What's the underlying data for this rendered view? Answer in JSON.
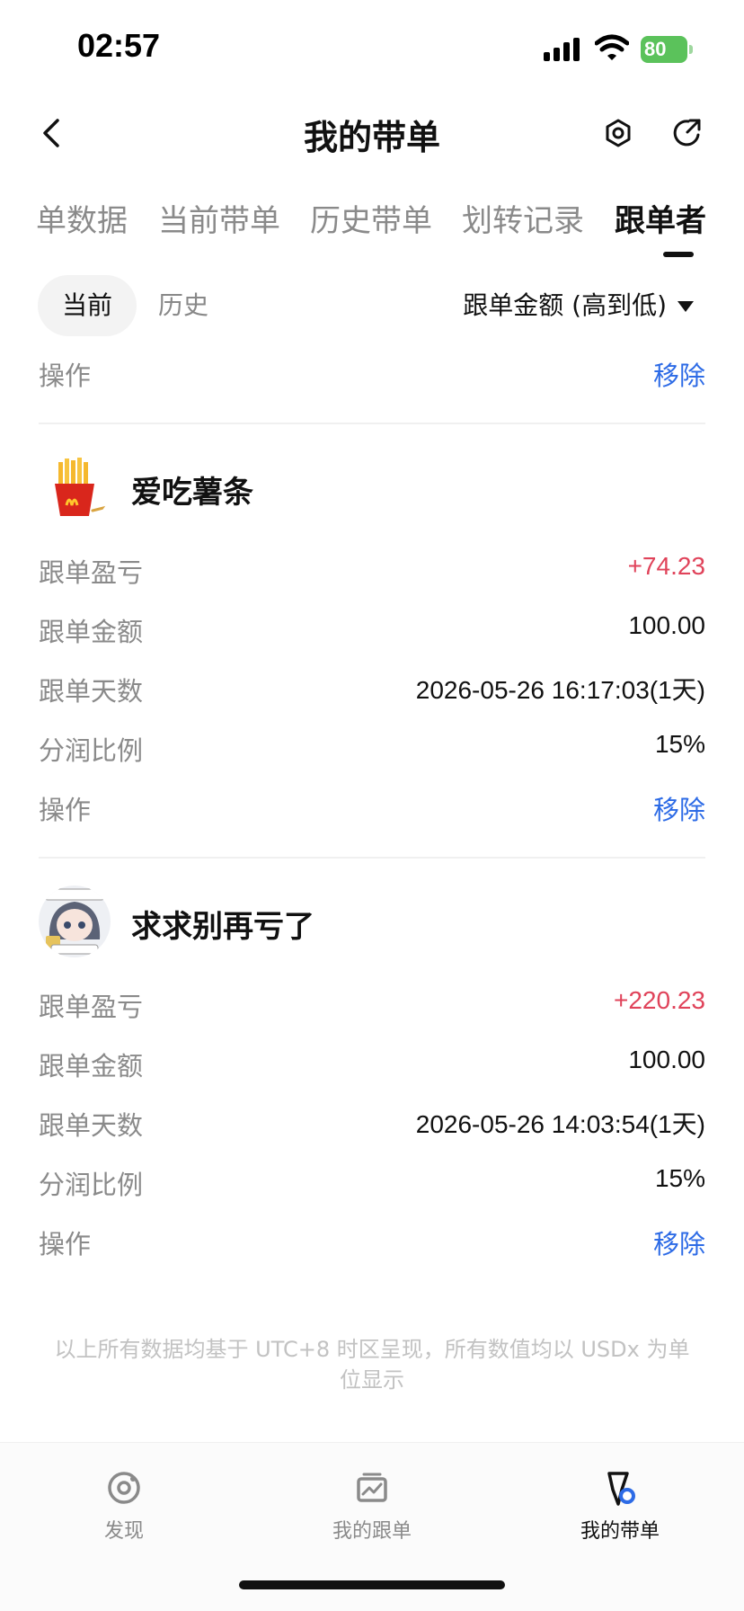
{
  "status_bar": {
    "time": "02:57",
    "battery": "80"
  },
  "header": {
    "title": "我的带单"
  },
  "tabs": [
    {
      "label": "单数据",
      "active": false
    },
    {
      "label": "当前带单",
      "active": false
    },
    {
      "label": "历史带单",
      "active": false
    },
    {
      "label": "划转记录",
      "active": false
    },
    {
      "label": "跟单者",
      "active": true
    }
  ],
  "subtabs": {
    "current": "当前",
    "history": "历史"
  },
  "sort": {
    "selected": "跟单金额 (高到低)"
  },
  "top_row": {
    "label": "操作",
    "action": "移除"
  },
  "followers": [
    {
      "name": "爱吃薯条",
      "avatar_icon": "french-fries-icon",
      "rows": [
        {
          "label": "跟单盈亏",
          "value": "+74.23"
        },
        {
          "label": "跟单金额",
          "value": "100.00"
        },
        {
          "label": "跟单天数",
          "value": "2026-05-26 16:17:03(1天)"
        },
        {
          "label": "分润比例",
          "value": "15%"
        },
        {
          "label": "操作",
          "value": "移除"
        }
      ]
    },
    {
      "name": "求求别再亏了",
      "avatar_icon": "anime-girl-avatar",
      "rows": [
        {
          "label": "跟单盈亏",
          "value": "+220.23"
        },
        {
          "label": "跟单金额",
          "value": "100.00"
        },
        {
          "label": "跟单天数",
          "value": "2026-05-26 14:03:54(1天)"
        },
        {
          "label": "分润比例",
          "value": "15%"
        },
        {
          "label": "操作",
          "value": "移除"
        }
      ]
    }
  ],
  "footnote": "以上所有数据均基于 UTC+8 时区呈现，所有数值均以 USDx 为单位显示",
  "bottom_nav": [
    {
      "label": "发现",
      "icon": "discover-icon",
      "active": false
    },
    {
      "label": "我的跟单",
      "icon": "chart-icon",
      "active": false
    },
    {
      "label": "我的带单",
      "icon": "lead-trade-icon",
      "active": true
    }
  ],
  "colors": {
    "profit": "#e0435a",
    "action": "#2d6be6",
    "battery": "#5bc25b"
  }
}
